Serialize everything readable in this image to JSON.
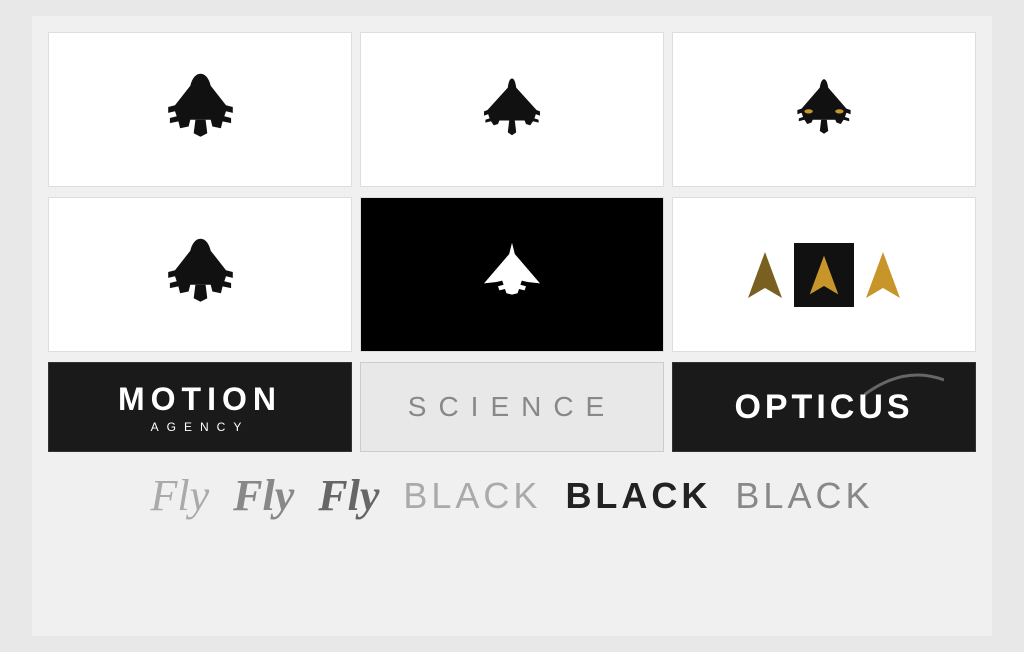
{
  "grid": {
    "rows": [
      {
        "cells": [
          {
            "id": "cell-1",
            "bg": "white",
            "content": "plane-large-fat"
          },
          {
            "id": "cell-2",
            "bg": "white",
            "content": "plane-medium-slim"
          },
          {
            "id": "cell-3",
            "bg": "white",
            "content": "plane-small-gold"
          }
        ]
      },
      {
        "cells": [
          {
            "id": "cell-4",
            "bg": "white",
            "content": "plane-large-fat2"
          },
          {
            "id": "cell-5",
            "bg": "black",
            "content": "plane-white-jet"
          },
          {
            "id": "cell-6",
            "bg": "white",
            "content": "arrows"
          }
        ]
      }
    ],
    "banners": [
      {
        "id": "banner-1",
        "bg": "dark",
        "text": "MOTION",
        "subtext": "AGENCY"
      },
      {
        "id": "banner-2",
        "bg": "light-gray",
        "text": "SCIENCE"
      },
      {
        "id": "banner-3",
        "bg": "dark",
        "text": "OPTICUS"
      }
    ]
  },
  "text_row": {
    "fly_labels": [
      "Fly",
      "Fly",
      "Fly"
    ],
    "black_labels": [
      "BLACK",
      "BLACK",
      "BLACK"
    ]
  },
  "colors": {
    "gold": "#c8952a",
    "dark_gold": "#a07020",
    "black": "#000000",
    "white": "#ffffff",
    "dark_bg": "#1a1a1a"
  }
}
